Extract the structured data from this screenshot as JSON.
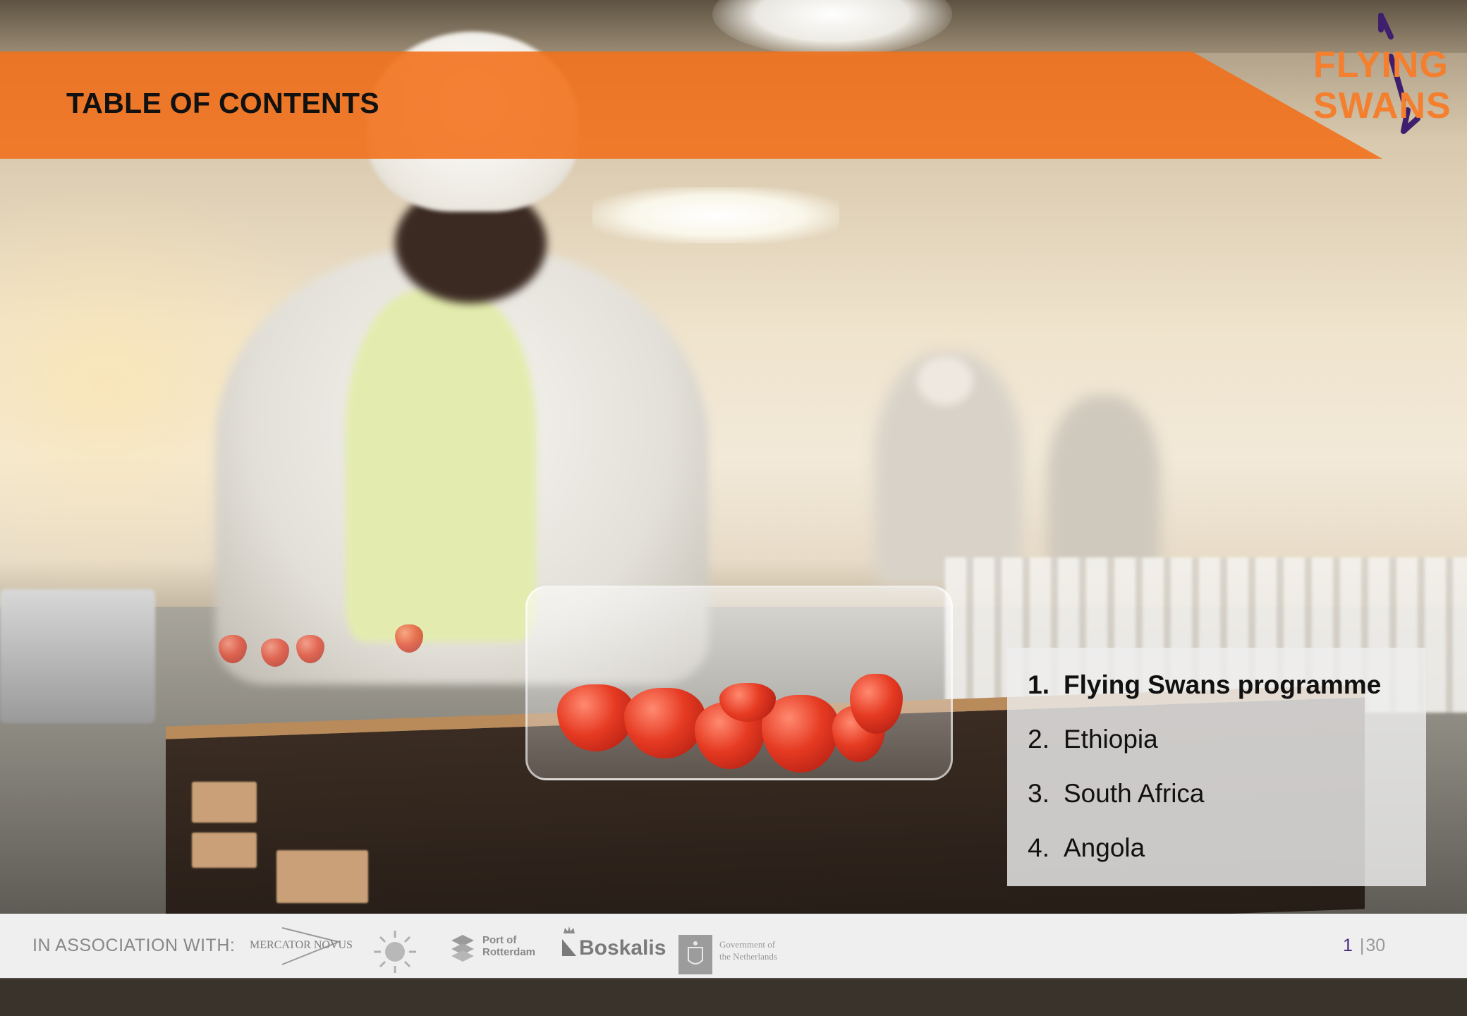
{
  "header": {
    "title": "TABLE OF CONTENTS"
  },
  "logo": {
    "line1": "FLYING",
    "line2": "SWANS",
    "color": "#f47f2f",
    "accent": "#3d1f6e"
  },
  "toc": {
    "items": [
      {
        "num": "1.",
        "label": "Flying Swans programme",
        "active": true
      },
      {
        "num": "2.",
        "label": "Ethiopia",
        "active": false
      },
      {
        "num": "3.",
        "label": "South Africa",
        "active": false
      },
      {
        "num": "4.",
        "label": "Angola",
        "active": false
      }
    ]
  },
  "footer": {
    "association_label": "IN ASSOCIATION WITH:",
    "partners": {
      "mercator": "MERCATOR NOVUS",
      "rotterdam_line1": "Port of",
      "rotterdam_line2": "Rotterdam",
      "boskalis": "Boskalis",
      "government_line1": "Government of",
      "government_line2": "the Netherlands"
    },
    "page": {
      "current": "1",
      "separator": "|",
      "total": "30"
    }
  },
  "colors": {
    "banner": "#f16e18",
    "page_current": "#4a2a7a",
    "footer_bg": "#efefef"
  },
  "background": {
    "description_icon": "photo-background"
  }
}
